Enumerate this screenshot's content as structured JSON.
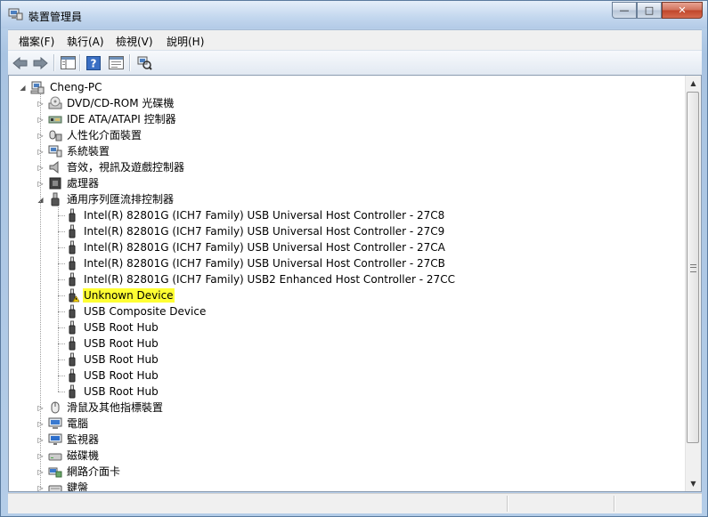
{
  "window": {
    "title": "裝置管理員",
    "buttons": {
      "minimize": "—",
      "maximize": "□",
      "close": "✕"
    }
  },
  "menu": [
    "檔案(F)",
    "執行(A)",
    "檢視(V)",
    "說明(H)"
  ],
  "toolbar": [
    "back-arrow-icon",
    "forward-arrow-icon",
    "show-hide-tree-icon",
    "help-icon",
    "properties-icon",
    "scan-hardware-icon"
  ],
  "tree": {
    "root": "Cheng-PC",
    "categories": [
      {
        "label": "DVD/CD-ROM 光碟機",
        "icon": "dvd-drive-icon",
        "expanded": false
      },
      {
        "label": "IDE ATA/ATAPI 控制器",
        "icon": "ide-controller-icon",
        "expanded": false
      },
      {
        "label": "人性化介面裝置",
        "icon": "hid-icon",
        "expanded": false
      },
      {
        "label": "系統裝置",
        "icon": "system-devices-icon",
        "expanded": false
      },
      {
        "label": "音效，視訊及遊戲控制器",
        "icon": "sound-icon",
        "expanded": false
      },
      {
        "label": "處理器",
        "icon": "processor-icon",
        "expanded": false
      },
      {
        "label": "通用序列匯流排控制器",
        "icon": "usb-controller-icon",
        "expanded": true,
        "children": [
          {
            "label": "Intel(R) 82801G (ICH7 Family) USB Universal Host Controller - 27C8",
            "warning": false
          },
          {
            "label": "Intel(R) 82801G (ICH7 Family) USB Universal Host Controller - 27C9",
            "warning": false
          },
          {
            "label": "Intel(R) 82801G (ICH7 Family) USB Universal Host Controller - 27CA",
            "warning": false
          },
          {
            "label": "Intel(R) 82801G (ICH7 Family) USB Universal Host Controller - 27CB",
            "warning": false
          },
          {
            "label": "Intel(R) 82801G (ICH7 Family) USB2 Enhanced Host Controller - 27CC",
            "warning": false
          },
          {
            "label": "Unknown Device",
            "warning": true,
            "highlighted": true
          },
          {
            "label": "USB Composite Device",
            "warning": false
          },
          {
            "label": "USB Root Hub",
            "warning": false
          },
          {
            "label": "USB Root Hub",
            "warning": false
          },
          {
            "label": "USB Root Hub",
            "warning": false
          },
          {
            "label": "USB Root Hub",
            "warning": false
          },
          {
            "label": "USB Root Hub",
            "warning": false
          }
        ]
      },
      {
        "label": "滑鼠及其他指標裝置",
        "icon": "mouse-icon",
        "expanded": false
      },
      {
        "label": "電腦",
        "icon": "computer-icon",
        "expanded": false
      },
      {
        "label": "監視器",
        "icon": "monitor-icon",
        "expanded": false
      },
      {
        "label": "磁碟機",
        "icon": "disk-drive-icon",
        "expanded": false
      },
      {
        "label": "網路介面卡",
        "icon": "network-adapter-icon",
        "expanded": false
      },
      {
        "label": "鍵盤",
        "icon": "keyboard-icon",
        "expanded": false
      }
    ]
  },
  "colors": {
    "highlight": "#ffff33",
    "title_gradient_top": "#e4eef9",
    "close_red": "#c0452a"
  }
}
